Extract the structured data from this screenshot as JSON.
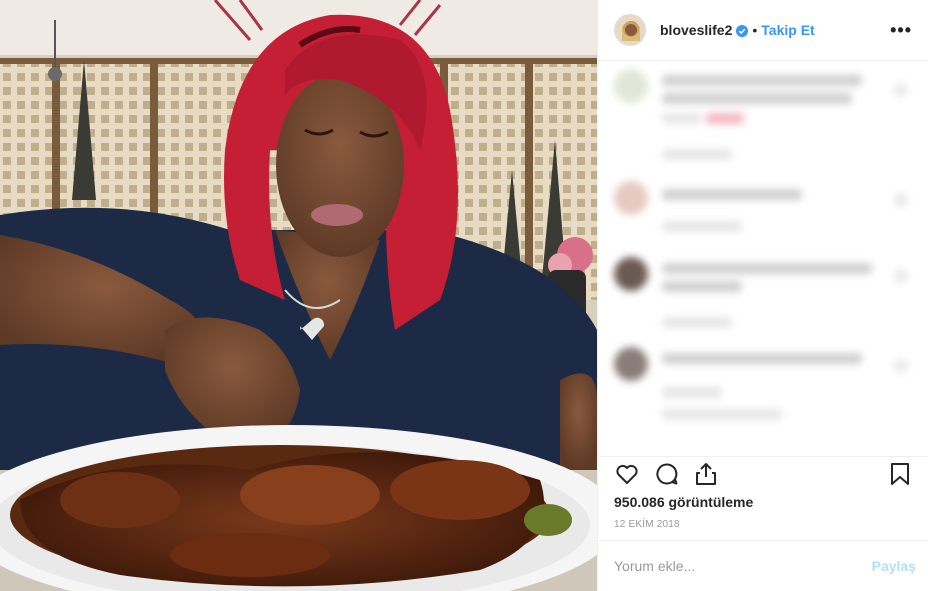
{
  "post": {
    "username": "bloveslife2",
    "separator": "•",
    "follow_label": "Takip Et",
    "more_label": "•••",
    "views": "950.086 görüntüleme",
    "date": "12 EKİM 2018"
  },
  "comment_box": {
    "placeholder": "Yorum ekle...",
    "share_label": "Paylaş"
  },
  "colors": {
    "accent": "#3897f0",
    "share_disabled": "#b2dffc",
    "hair": "#c51f36",
    "shirt": "#1c2a45"
  },
  "icons": [
    "verified-badge-icon",
    "heart-icon",
    "comment-icon",
    "share-icon",
    "bookmark-icon",
    "more-icon"
  ]
}
